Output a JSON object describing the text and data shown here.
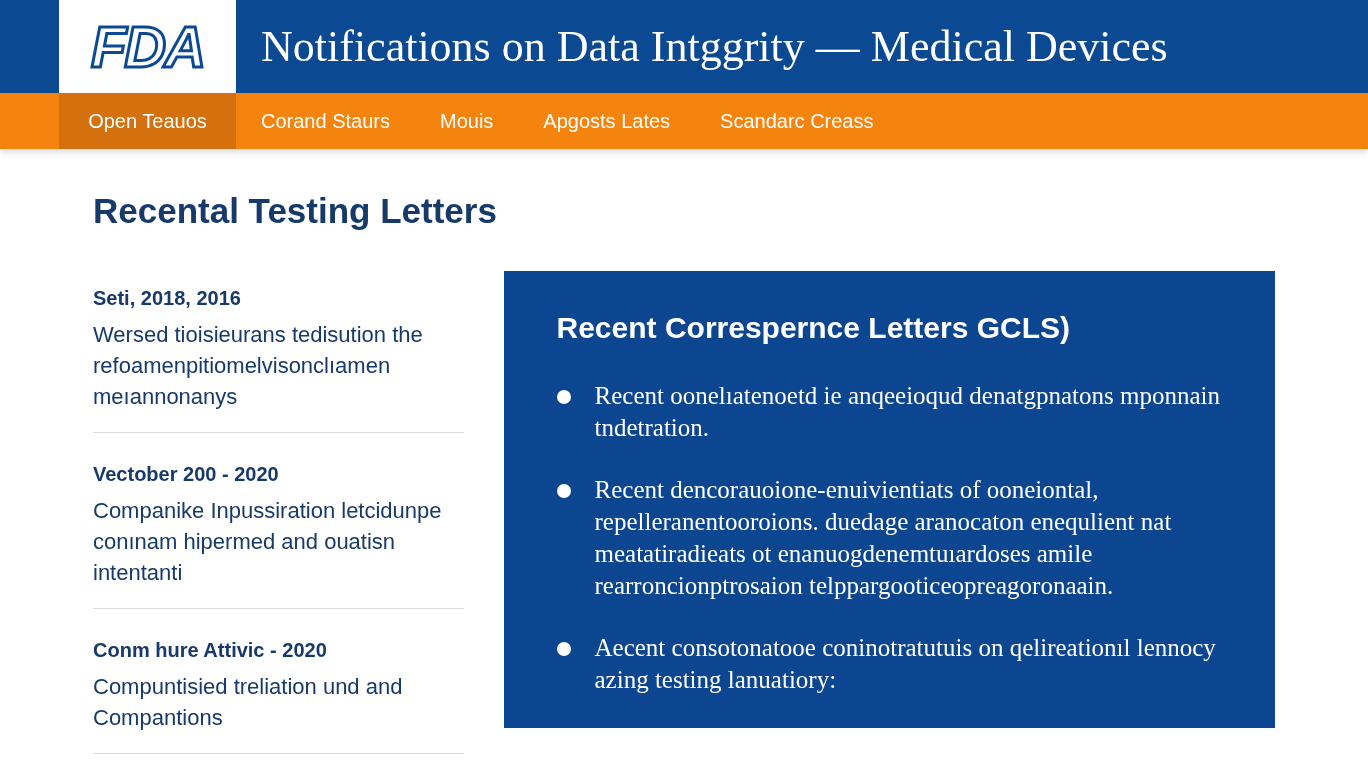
{
  "header": {
    "logo": "FDA",
    "title": "Notifications on Data Intggrity — Medical Devices"
  },
  "nav": [
    {
      "label": "Open Teauos",
      "selected": true
    },
    {
      "label": "Corand Staurs",
      "selected": false
    },
    {
      "label": "Mouis",
      "selected": false
    },
    {
      "label": "Apgosts Lates",
      "selected": false
    },
    {
      "label": "Scandarc Creass",
      "selected": false
    }
  ],
  "section_title": "Recental Testing Letters",
  "letters": [
    {
      "date": "Seti, 2018, 2016",
      "summary": "Wersed tioisieurans tedisution the refoamenpitiomelvisonclıamen meıannonanys"
    },
    {
      "date": "Vectober 200 - 2020",
      "summary": "Companike Inpussiration letcidunpe conınam hipermed and ouatisn intentanti"
    },
    {
      "date": "Conm hure Attivic - 2020",
      "summary": "Compuntisied treliation und and Compantions"
    }
  ],
  "panel": {
    "title": "Recent Correspernce Letters GCLS)",
    "bullets": [
      "Recent oonelıatenoetd ie anqeeioqud denatgpnatons mponnain tndetration.",
      "Recent dencorauoione-enuivientiats of ooneiontal, repelleranentooroions. duedage aranocaton enequlient nat meatatiradieats ot enanuogdenemtuıardoses amile rearroncionptrosaion telppargooticeopreagoronaain.",
      "Aecent consotonatooe coninotratutuis on qelireationıl lennocy azing testing lanuatiory:"
    ]
  }
}
